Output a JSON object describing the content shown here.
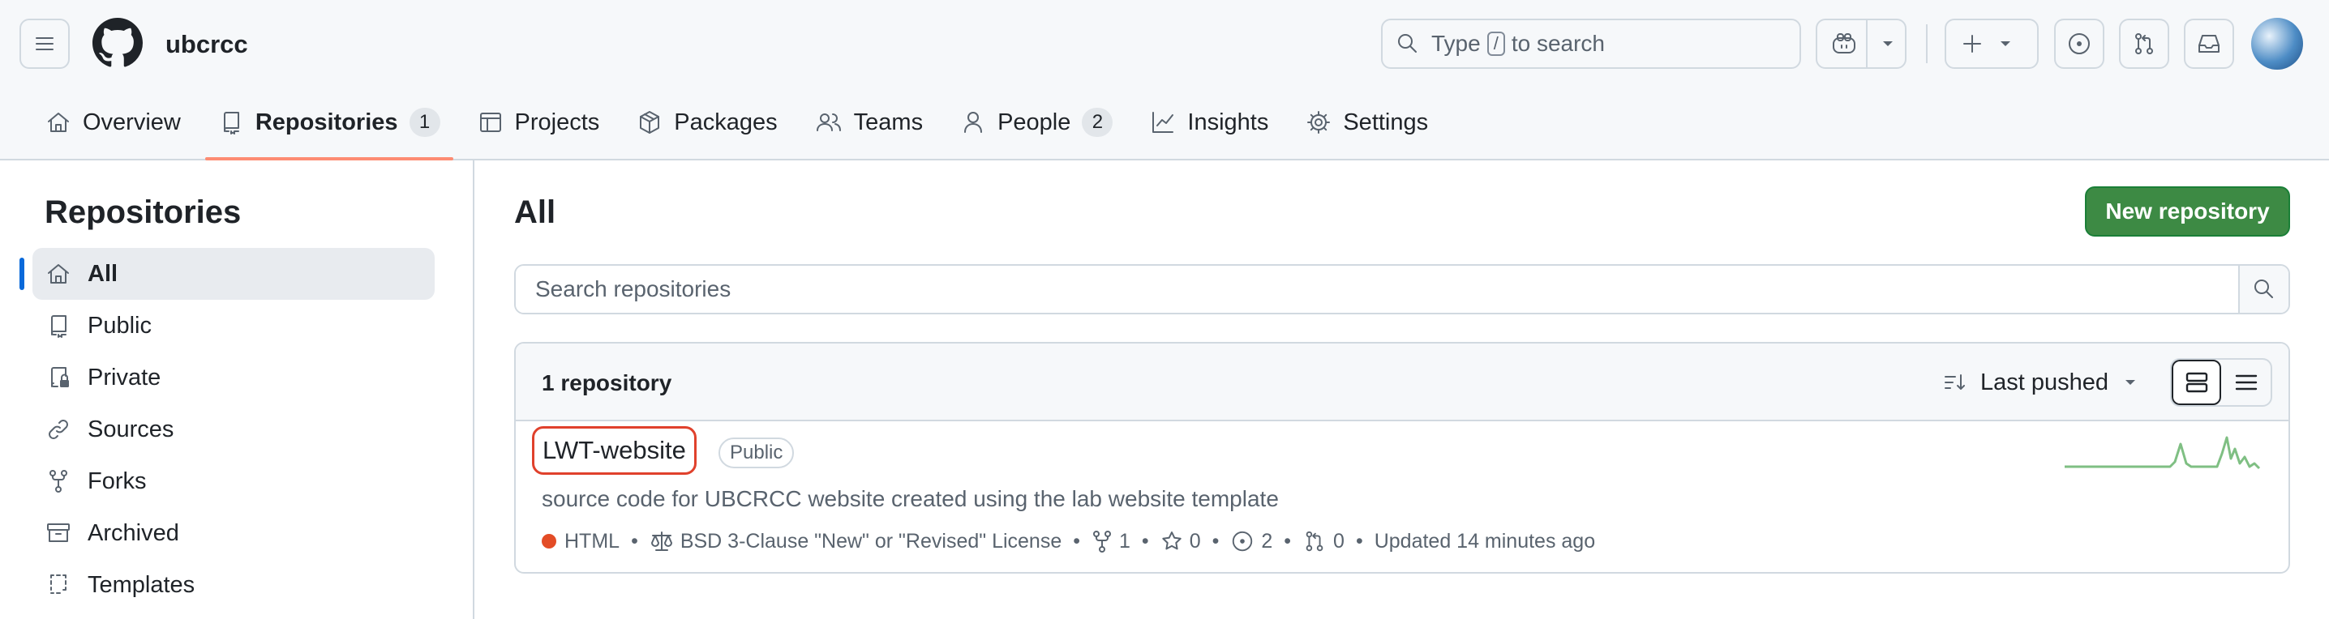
{
  "header": {
    "org_name": "ubcrcc",
    "search_prefix": "Type",
    "search_key": "/",
    "search_suffix": "to search"
  },
  "tabs": [
    {
      "label": "Overview"
    },
    {
      "label": "Repositories",
      "count": "1"
    },
    {
      "label": "Projects"
    },
    {
      "label": "Packages"
    },
    {
      "label": "Teams"
    },
    {
      "label": "People",
      "count": "2"
    },
    {
      "label": "Insights"
    },
    {
      "label": "Settings"
    }
  ],
  "sidebar": {
    "title": "Repositories",
    "items": [
      {
        "label": "All"
      },
      {
        "label": "Public"
      },
      {
        "label": "Private"
      },
      {
        "label": "Sources"
      },
      {
        "label": "Forks"
      },
      {
        "label": "Archived"
      },
      {
        "label": "Templates"
      }
    ]
  },
  "main": {
    "title": "All",
    "new_repo_label": "New repository",
    "search_placeholder": "Search repositories",
    "repo_count": "1 repository",
    "sort_label": "Last pushed"
  },
  "repo": {
    "name": "LWT-website",
    "visibility": "Public",
    "description": "source code for UBCRCC website created using the lab website template",
    "language": "HTML",
    "language_color": "#e34c26",
    "license": "BSD 3-Clause \"New\" or \"Revised\" License",
    "forks": "1",
    "stars": "0",
    "issues": "2",
    "pull_requests": "0",
    "updated": "Updated 14 minutes ago"
  },
  "colors": {
    "accent": "#0969da",
    "primary_button": "#3d8a44",
    "tab_underline": "#fd8c73",
    "sparkline": "#7fbf83"
  }
}
